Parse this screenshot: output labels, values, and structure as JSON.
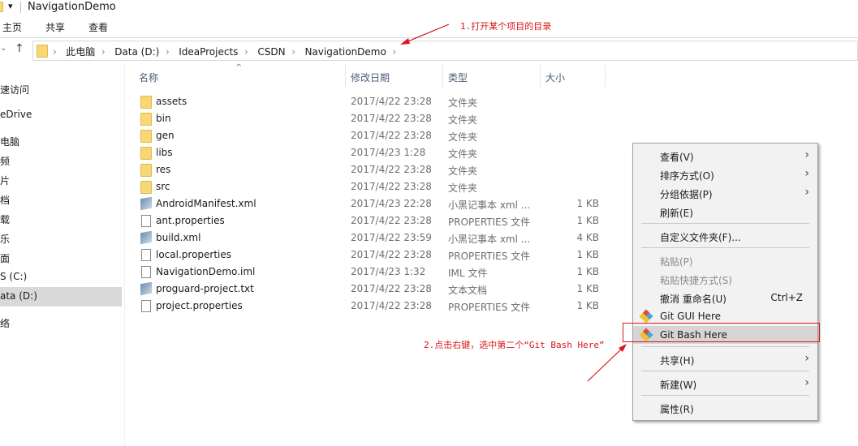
{
  "window": {
    "title": "NavigationDemo"
  },
  "ribbon": {
    "tabs": [
      "主页",
      "共享",
      "查看"
    ]
  },
  "address": {
    "crumbs": [
      "此电脑",
      "Data (D:)",
      "IdeaProjects",
      "CSDN",
      "NavigationDemo"
    ]
  },
  "sidebar": {
    "items": [
      "速访问",
      "eDrive",
      "电脑",
      "频",
      "片",
      "档",
      "载",
      "乐",
      "面",
      "S (C:)",
      "ata (D:)",
      "络"
    ],
    "selected": "ata (D:)"
  },
  "columns": {
    "name": "名称",
    "date": "修改日期",
    "type": "类型",
    "size": "大小"
  },
  "files": [
    {
      "name": "assets",
      "date": "2017/4/22 23:28",
      "type": "文件夹",
      "size": "",
      "icon": "folder"
    },
    {
      "name": "bin",
      "date": "2017/4/22 23:28",
      "type": "文件夹",
      "size": "",
      "icon": "folder"
    },
    {
      "name": "gen",
      "date": "2017/4/22 23:28",
      "type": "文件夹",
      "size": "",
      "icon": "folder"
    },
    {
      "name": "libs",
      "date": "2017/4/23 1:28",
      "type": "文件夹",
      "size": "",
      "icon": "folder"
    },
    {
      "name": "res",
      "date": "2017/4/22 23:28",
      "type": "文件夹",
      "size": "",
      "icon": "folder"
    },
    {
      "name": "src",
      "date": "2017/4/22 23:28",
      "type": "文件夹",
      "size": "",
      "icon": "folder"
    },
    {
      "name": "AndroidManifest.xml",
      "date": "2017/4/23 22:28",
      "type": "小黑记事本 xml ...",
      "size": "1 KB",
      "icon": "notepad"
    },
    {
      "name": "ant.properties",
      "date": "2017/4/22 23:28",
      "type": "PROPERTIES 文件",
      "size": "1 KB",
      "icon": "file"
    },
    {
      "name": "build.xml",
      "date": "2017/4/22 23:59",
      "type": "小黑记事本 xml ...",
      "size": "4 KB",
      "icon": "notepad"
    },
    {
      "name": "local.properties",
      "date": "2017/4/22 23:28",
      "type": "PROPERTIES 文件",
      "size": "1 KB",
      "icon": "file"
    },
    {
      "name": "NavigationDemo.iml",
      "date": "2017/4/23 1:32",
      "type": "IML 文件",
      "size": "1 KB",
      "icon": "file"
    },
    {
      "name": "proguard-project.txt",
      "date": "2017/4/22 23:28",
      "type": "文本文档",
      "size": "1 KB",
      "icon": "notepad"
    },
    {
      "name": "project.properties",
      "date": "2017/4/22 23:28",
      "type": "PROPERTIES 文件",
      "size": "1 KB",
      "icon": "file"
    }
  ],
  "context_menu": {
    "items": [
      {
        "label": "查看(V)",
        "submenu": true
      },
      {
        "label": "排序方式(O)",
        "submenu": true
      },
      {
        "label": "分组依据(P)",
        "submenu": true
      },
      {
        "label": "刷新(E)"
      },
      {
        "label": "自定义文件夹(F)..."
      },
      {
        "label": "粘贴(P)",
        "disabled": true
      },
      {
        "label": "粘贴快捷方式(S)",
        "disabled": true
      },
      {
        "label": "撤消 重命名(U)",
        "shortcut": "Ctrl+Z"
      },
      {
        "label": "Git GUI Here",
        "icon": "git-icon"
      },
      {
        "label": "Git Bash Here",
        "icon": "git-icon",
        "highlighted": true
      },
      {
        "label": "共享(H)",
        "submenu": true
      },
      {
        "label": "新建(W)",
        "submenu": true
      },
      {
        "label": "属性(R)"
      }
    ]
  },
  "annotations": {
    "step1": "1.打开某个项目的目录",
    "step2": "2.点击右键，选中第二个“Git Bash Here”",
    "color": "#d8161b"
  }
}
